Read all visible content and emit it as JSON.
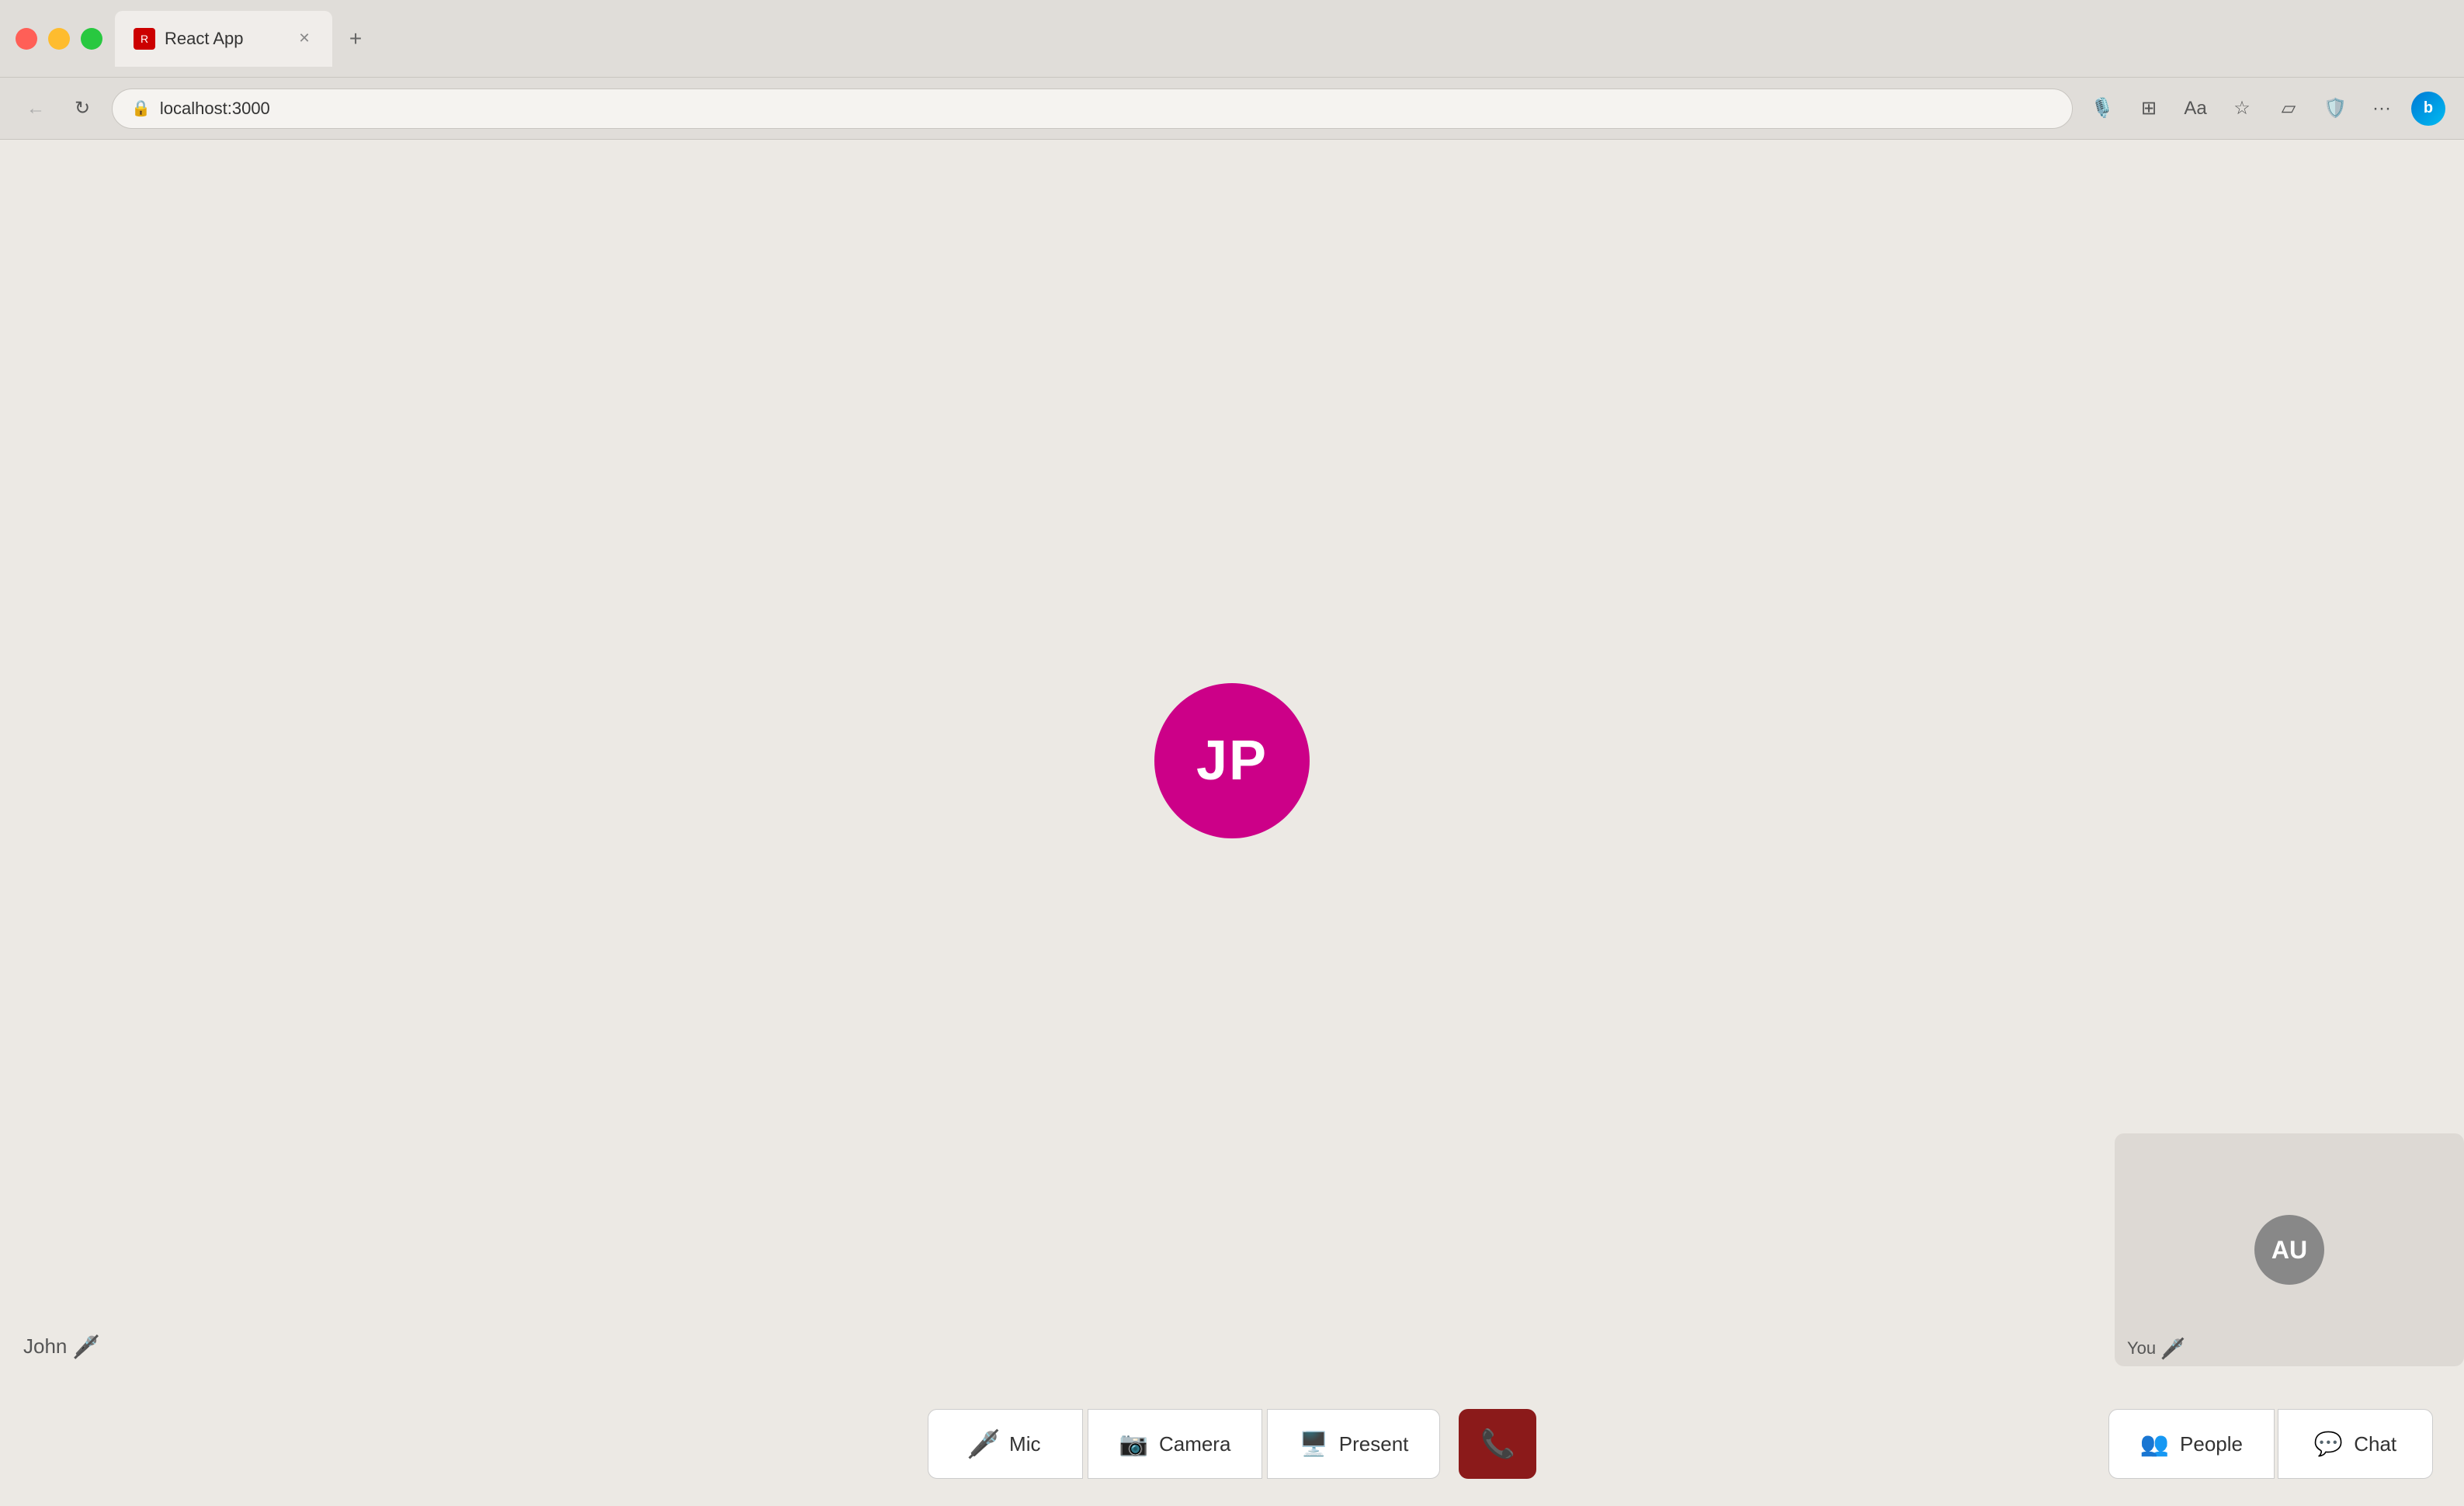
{
  "browser": {
    "tab_title": "React App",
    "url": "localhost:3000",
    "favicon_letter": "R"
  },
  "call": {
    "main_participant_initials": "JP",
    "main_participant_color": "#cc0088",
    "john_label": "John",
    "you_label": "You",
    "you_avatar_initials": "AU",
    "you_avatar_color": "#888888"
  },
  "controls": {
    "mic_label": "Mic",
    "camera_label": "Camera",
    "present_label": "Present",
    "people_label": "People",
    "chat_label": "Chat"
  }
}
